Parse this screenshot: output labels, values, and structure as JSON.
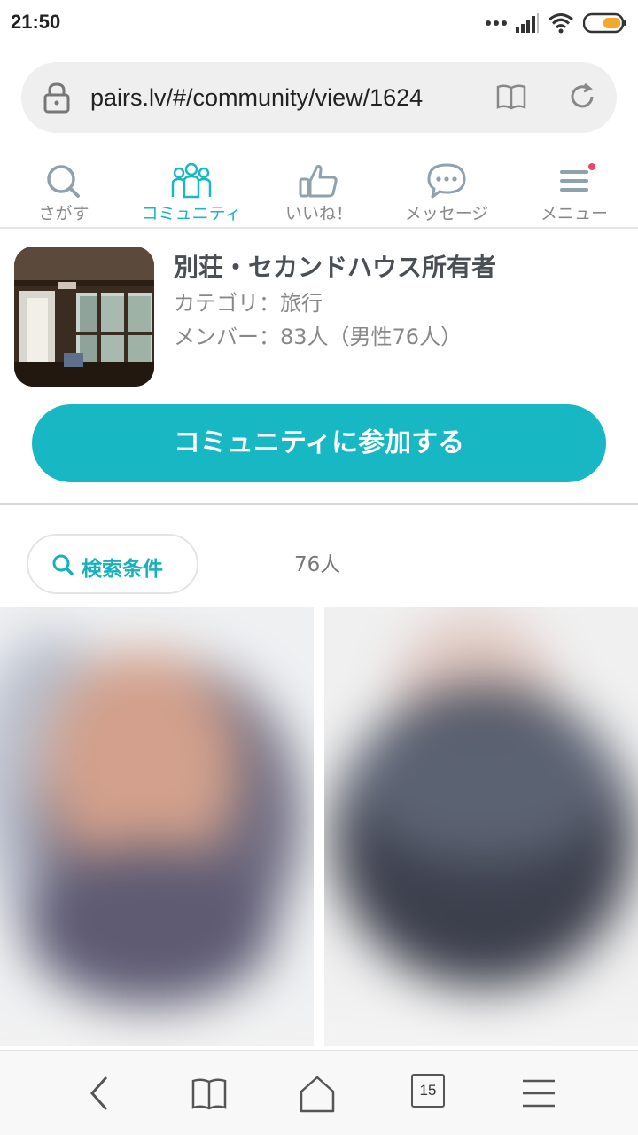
{
  "status_bar": {
    "time": "21:50"
  },
  "browser": {
    "url": "pairs.lv/#/community/view/1624"
  },
  "tabs": [
    {
      "label": "さがす",
      "icon": "search-icon",
      "active": false
    },
    {
      "label": "コミュニティ",
      "icon": "community-icon",
      "active": true
    },
    {
      "label": "いいね！",
      "icon": "thumbs-up-icon",
      "active": false
    },
    {
      "label": "メッセージ",
      "icon": "message-icon",
      "active": false
    },
    {
      "label": "メニュー",
      "icon": "menu-icon",
      "active": false
    }
  ],
  "community": {
    "title": "別荘・セカンドハウス所有者",
    "category": "カテゴリ：旅行",
    "members": "メンバー：83人（男性76人）"
  },
  "join_button": "コミュニティに参加する",
  "search": {
    "label": "検索条件",
    "count": "76人"
  },
  "bottom_bar": {
    "tab_count": "15"
  },
  "colors": {
    "accent": "#17b8c4",
    "badge": "#ee4466"
  }
}
